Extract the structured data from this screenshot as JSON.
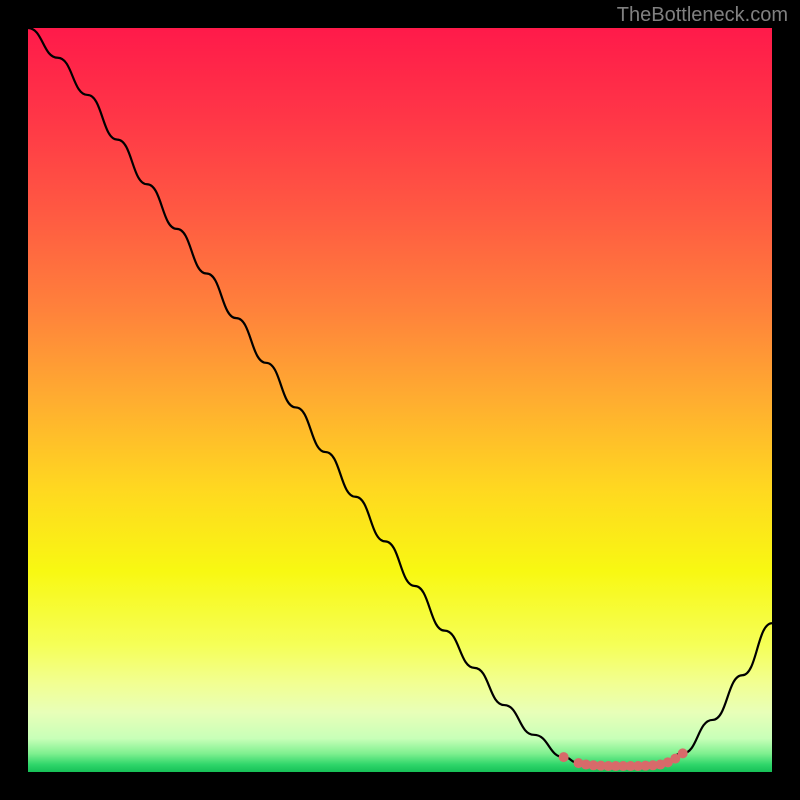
{
  "watermark": "TheBottleneck.com",
  "chart_data": {
    "type": "line",
    "title": "",
    "xlabel": "",
    "ylabel": "",
    "xlim": [
      0,
      100
    ],
    "ylim": [
      0,
      100
    ],
    "series": [
      {
        "name": "curve",
        "color": "#000000",
        "x": [
          0,
          4,
          8,
          12,
          16,
          20,
          24,
          28,
          32,
          36,
          40,
          44,
          48,
          52,
          56,
          60,
          64,
          68,
          72,
          74,
          75,
          78,
          82,
          84,
          85,
          88,
          92,
          96,
          100
        ],
        "y": [
          100,
          96,
          91,
          85,
          79,
          73,
          67,
          61,
          55,
          49,
          43,
          37,
          31,
          25,
          19,
          14,
          9,
          5,
          2,
          1.2,
          1,
          0.8,
          0.8,
          0.9,
          1,
          2.5,
          7,
          13,
          20
        ]
      },
      {
        "name": "bottom-dots",
        "color": "#d86a6a",
        "type": "scatter",
        "x": [
          72,
          74,
          75,
          76,
          77,
          78,
          79,
          80,
          81,
          82,
          83,
          84,
          85,
          86,
          87,
          88
        ],
        "y": [
          2,
          1.2,
          1,
          0.9,
          0.85,
          0.8,
          0.8,
          0.8,
          0.8,
          0.8,
          0.85,
          0.9,
          1,
          1.3,
          1.8,
          2.5
        ]
      }
    ],
    "gradient_stops": [
      {
        "offset": 0,
        "color": "#ff1a4a"
      },
      {
        "offset": 0.12,
        "color": "#ff3647"
      },
      {
        "offset": 0.25,
        "color": "#ff5a42"
      },
      {
        "offset": 0.38,
        "color": "#ff823b"
      },
      {
        "offset": 0.5,
        "color": "#ffad30"
      },
      {
        "offset": 0.62,
        "color": "#ffd820"
      },
      {
        "offset": 0.73,
        "color": "#f8f812"
      },
      {
        "offset": 0.83,
        "color": "#f5ff58"
      },
      {
        "offset": 0.88,
        "color": "#f2ff91"
      },
      {
        "offset": 0.92,
        "color": "#e8ffb8"
      },
      {
        "offset": 0.955,
        "color": "#c8ffb8"
      },
      {
        "offset": 0.975,
        "color": "#80f090"
      },
      {
        "offset": 0.99,
        "color": "#2fd66a"
      },
      {
        "offset": 1.0,
        "color": "#16c057"
      }
    ]
  }
}
